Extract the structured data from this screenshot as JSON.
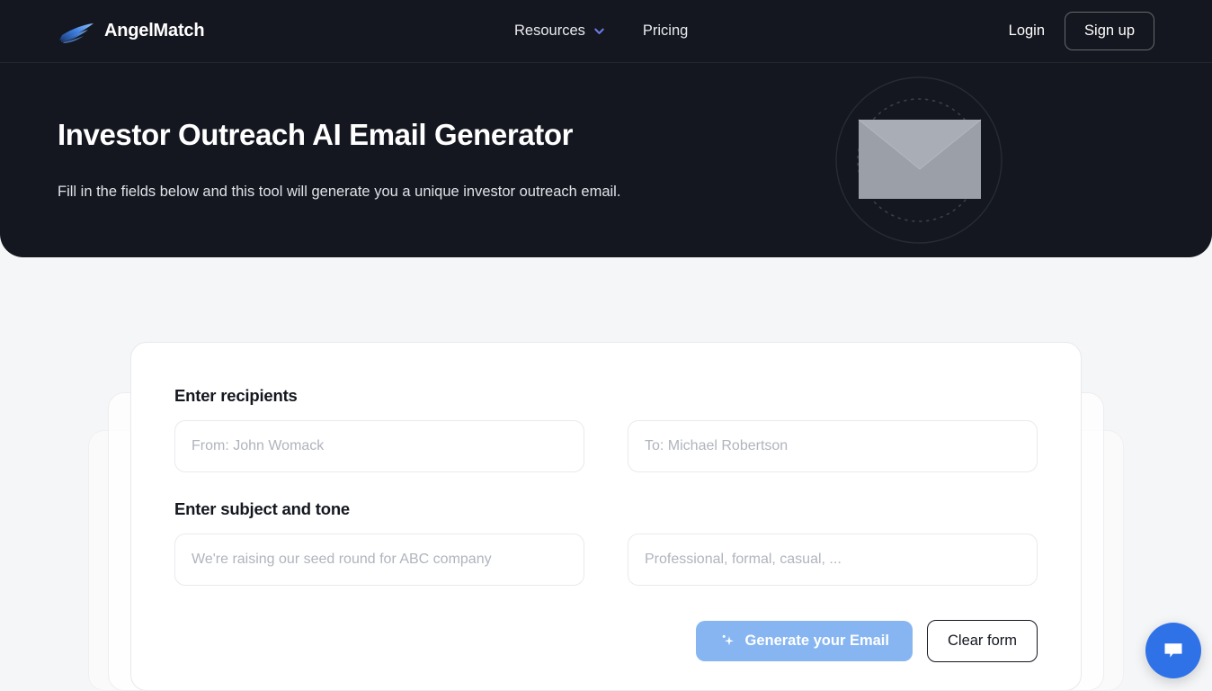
{
  "brand": {
    "name": "AngelMatch",
    "logo_icon": "wing-logo-icon"
  },
  "nav": {
    "center_items": [
      {
        "label": "Resources",
        "has_dropdown": true,
        "icon": "chevron-down-icon"
      },
      {
        "label": "Pricing",
        "has_dropdown": false
      }
    ],
    "login_label": "Login",
    "signup_label": "Sign up"
  },
  "hero": {
    "title": "Investor Outreach AI Email Generator",
    "subtitle": "Fill in the fields below and this tool will generate you a unique investor outreach email.",
    "art_icon": "envelope-icon",
    "background_color": "#14171f"
  },
  "form": {
    "recipients_label": "Enter recipients",
    "subject_tone_label": "Enter subject and tone",
    "fields": {
      "from": {
        "value": "",
        "placeholder": "From: John Womack"
      },
      "to": {
        "value": "",
        "placeholder": "To: Michael Robertson"
      },
      "subject": {
        "value": "",
        "placeholder": "We're raising our seed round for ABC company"
      },
      "tone": {
        "value": "",
        "placeholder": "Professional, formal, casual, ..."
      }
    },
    "generate_label": "Generate your Email",
    "generate_icon": "sparkle-icon",
    "generate_color": "#86b5f2",
    "clear_label": "Clear form"
  },
  "chat": {
    "icon": "chat-bubble-icon",
    "color": "#2f72e8"
  }
}
